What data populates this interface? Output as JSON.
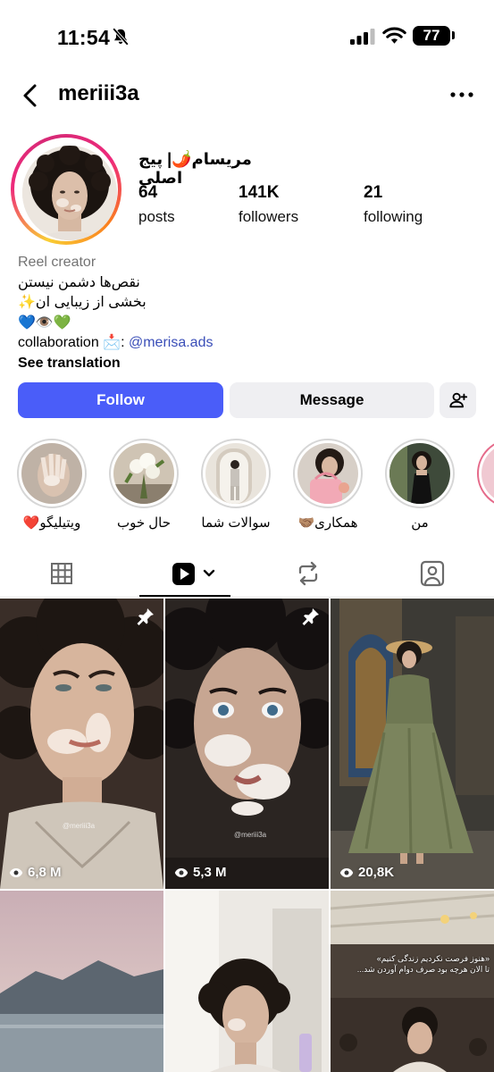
{
  "status_bar": {
    "time": "11:54",
    "battery": "77"
  },
  "header": {
    "username": "meriii3a"
  },
  "profile": {
    "display_name": "مریسام🌶️| پیج اصلی",
    "stats": [
      {
        "value": "64",
        "label": "posts"
      },
      {
        "value": "141K",
        "label": "followers"
      },
      {
        "value": "21",
        "label": "following"
      }
    ],
    "category": "Reel creator",
    "bio_line1": "نقص‌ها دشمن نیستن",
    "bio_line2": "بخشی از زیبایی ان✨",
    "bio_line3": "💙👁️💚",
    "collab_prefix": "collaboration 📩: ",
    "collab_handle": "@merisa.ads",
    "see_translation": "See translation"
  },
  "actions": {
    "follow": "Follow",
    "message": "Message"
  },
  "highlights": [
    {
      "label": "ویتیلیگو❤️"
    },
    {
      "label": "حال خوب"
    },
    {
      "label": "سوالات شما"
    },
    {
      "label": "همکاری🤝🏽"
    },
    {
      "label": "من"
    }
  ],
  "grid": [
    {
      "views": "6,8 M",
      "pinned": true
    },
    {
      "views": "5,3 M",
      "pinned": true
    },
    {
      "views": "20,8K",
      "pinned": false
    },
    {
      "overlay_line1": "«هنوز فرصت نکردیم زندگی کنیم»",
      "overlay_line2": "تا الان هرچه بود صرف دوام آوردن شد..."
    }
  ],
  "watermarks": [
    "@meriii3a",
    "@meriii3a"
  ],
  "colors": {
    "follow_button": "#4a5df9",
    "mention": "#3a4eb8",
    "secondary_button": "#efeff2"
  },
  "icons": [
    "back-icon",
    "more-icon",
    "add-user-icon",
    "grid-icon",
    "reels-icon",
    "reposts-icon",
    "tagged-icon",
    "eye-icon",
    "pin-icon"
  ]
}
